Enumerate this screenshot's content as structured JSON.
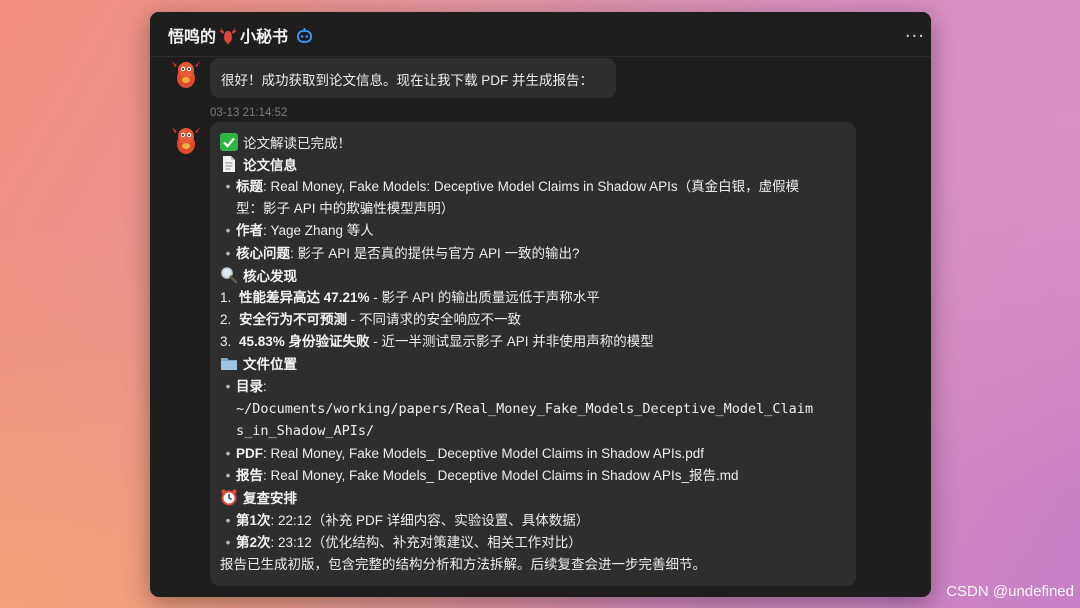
{
  "window": {
    "title_part1": "悟鸣的",
    "title_part2": "小秘书",
    "more_label": "···"
  },
  "messages": [
    {
      "text": "很好！成功获取到论文信息。现在让我下载 PDF 并生成报告："
    },
    {
      "timestamp": "03-13 21:14:52",
      "heading_done": "论文解读已完成！",
      "section_info": "论文信息",
      "info_title_label": "标题",
      "info_title_value_l1": ": Real Money, Fake Models: Deceptive Model Claims in Shadow APIs（真金白银，虚假模",
      "info_title_value_l2": "型：影子 API 中的欺骗性模型声明）",
      "info_author_label": "作者",
      "info_author_value": ": Yage Zhang 等人",
      "info_question_label": "核心问题",
      "info_question_value": ": 影子 API 是否真的提供与官方 API 一致的输出?",
      "section_findings": "核心发现",
      "findings": [
        {
          "n": "1.",
          "bold": "性能差异高达 47.21%",
          "rest": " - 影子 API 的输出质量远低于声称水平"
        },
        {
          "n": "2.",
          "bold": "安全行为不可预测",
          "rest": " - 不同请求的安全响应不一致"
        },
        {
          "n": "3.",
          "bold": "45.83% 身份验证失败",
          "rest": " - 近一半测试显示影子 API 并非使用声称的模型"
        }
      ],
      "section_files": "文件位置",
      "dir_label": "目录",
      "dir_colon": ":",
      "dir_path_l1": "~/Documents/working/papers/Real_Money_Fake_Models_Deceptive_Model_Claim",
      "dir_path_l2": "s_in_Shadow_APIs/",
      "pdf_label": "PDF",
      "pdf_value": ": Real Money, Fake Models_ Deceptive Model Claims in Shadow APIs.pdf",
      "report_label": "报告",
      "report_value": ": Real Money, Fake Models_ Deceptive Model Claims in Shadow APIs_报告.md",
      "section_review": "复查安排",
      "review1_label": "第1次",
      "review1_value": ": 22:12（补充 PDF 详细内容、实验设置、具体数据）",
      "review2_label": "第2次",
      "review2_value": ": 23:12（优化结构、补充对策建议、相关工作对比）",
      "closing": "报告已生成初版，包含完整的结构分析和方法拆解。后续复查会进一步完善细节。"
    }
  ],
  "watermark": "CSDN @undefined",
  "colors": {
    "accent_blue": "#3b9bff",
    "check_green": "#2fb344",
    "bubble_bg": "#2e2e2e",
    "window_bg": "#1e1e1e"
  },
  "icons": [
    "lobster-icon",
    "bot-icon",
    "more-icon",
    "check-mark-icon",
    "document-icon",
    "magnifier-icon",
    "folder-icon",
    "alarm-clock-icon",
    "avatar"
  ]
}
